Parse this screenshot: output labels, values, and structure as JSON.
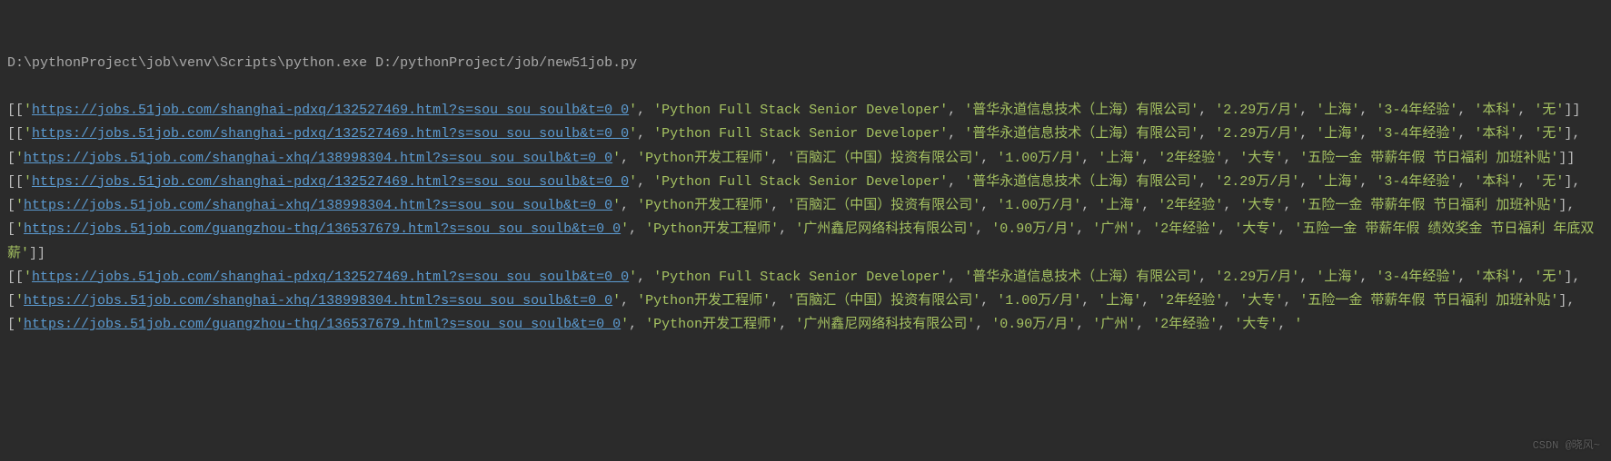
{
  "console": {
    "command_line": "D:\\pythonProject\\job\\venv\\Scripts\\python.exe D:/pythonProject/job/new51job.py",
    "iterations": [
      [
        {
          "url": "https://jobs.51job.com/shanghai-pdxq/132527469.html?s=sou_sou_soulb&t=0_0",
          "title": "Python Full Stack Senior Developer",
          "company": "普华永道信息技术（上海）有限公司",
          "salary": "2.29万/月",
          "city": "上海",
          "experience": "3-4年经验",
          "education": "本科",
          "benefits": "无"
        }
      ],
      [
        {
          "url": "https://jobs.51job.com/shanghai-pdxq/132527469.html?s=sou_sou_soulb&t=0_0",
          "title": "Python Full Stack Senior Developer",
          "company": "普华永道信息技术（上海）有限公司",
          "salary": "2.29万/月",
          "city": "上海",
          "experience": "3-4年经验",
          "education": "本科",
          "benefits": "无"
        },
        {
          "url": "https://jobs.51job.com/shanghai-xhq/138998304.html?s=sou_sou_soulb&t=0_0",
          "title": "Python开发工程师",
          "company": "百脑汇（中国）投资有限公司",
          "salary": "1.00万/月",
          "city": "上海",
          "experience": "2年经验",
          "education": "大专",
          "benefits": "五险一金 带薪年假 节日福利 加班补贴"
        }
      ],
      [
        {
          "url": "https://jobs.51job.com/shanghai-pdxq/132527469.html?s=sou_sou_soulb&t=0_0",
          "title": "Python Full Stack Senior Developer",
          "company": "普华永道信息技术（上海）有限公司",
          "salary": "2.29万/月",
          "city": "上海",
          "experience": "3-4年经验",
          "education": "本科",
          "benefits": "无"
        },
        {
          "url": "https://jobs.51job.com/shanghai-xhq/138998304.html?s=sou_sou_soulb&t=0_0",
          "title": "Python开发工程师",
          "company": "百脑汇（中国）投资有限公司",
          "salary": "1.00万/月",
          "city": "上海",
          "experience": "2年经验",
          "education": "大专",
          "benefits": "五险一金 带薪年假 节日福利 加班补贴"
        },
        {
          "url": "https://jobs.51job.com/guangzhou-thq/136537679.html?s=sou_sou_soulb&t=0_0",
          "title": "Python开发工程师",
          "company": "广州鑫尼网络科技有限公司",
          "salary": "0.90万/月",
          "city": "广州",
          "experience": "2年经验",
          "education": "大专",
          "benefits": "五险一金 带薪年假 绩效奖金 节日福利 年底双薪"
        }
      ],
      [
        {
          "url": "https://jobs.51job.com/shanghai-pdxq/132527469.html?s=sou_sou_soulb&t=0_0",
          "title": "Python Full Stack Senior Developer",
          "company": "普华永道信息技术（上海）有限公司",
          "salary": "2.29万/月",
          "city": "上海",
          "experience": "3-4年经验",
          "education": "本科",
          "benefits": "无"
        },
        {
          "url": "https://jobs.51job.com/shanghai-xhq/138998304.html?s=sou_sou_soulb&t=0_0",
          "title": "Python开发工程师",
          "company": "百脑汇（中国）投资有限公司",
          "salary": "1.00万/月",
          "city": "上海",
          "experience": "2年经验",
          "education": "大专",
          "benefits": "五险一金 带薪年假 节日福利 加班补贴"
        },
        {
          "url": "https://jobs.51job.com/guangzhou-thq/136537679.html?s=sou_sou_soulb&t=0_0",
          "title": "Python开发工程师",
          "company": "广州鑫尼网络科技有限公司",
          "salary": "0.90万/月",
          "city": "广州",
          "experience": "2年经验",
          "education": "大专",
          "benefits": ""
        }
      ]
    ],
    "last_truncated": true,
    "watermark": "CSDN @晓风~"
  }
}
